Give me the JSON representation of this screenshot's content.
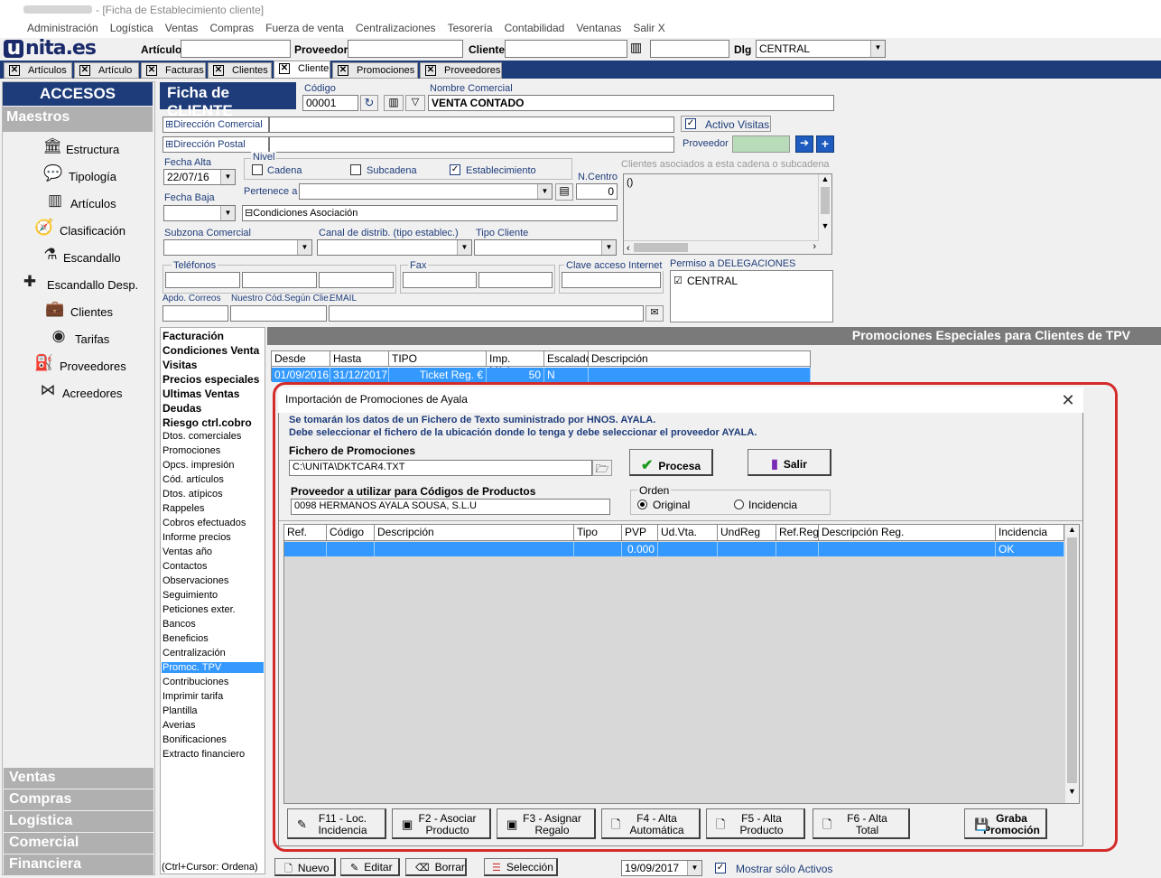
{
  "window": {
    "title": "- [Ficha de Establecimiento cliente]"
  },
  "menu": [
    "Administración",
    "Logística",
    "Ventas",
    "Compras",
    "Fuerza de venta",
    "Centralizaciones",
    "Tesorería",
    "Contabilidad",
    "Ventanas",
    "Salir X"
  ],
  "toolbar": {
    "logo": "unita.es",
    "articulo_label": "Artículo",
    "proveedor_label": "Proveedor",
    "cliente_label": "Cliente",
    "dlg_label": "Dlg",
    "dlg_value": "CENTRAL"
  },
  "tabs": [
    "Artículos",
    "Artículo",
    "Facturas",
    "Clientes",
    "Cliente",
    "Promociones",
    "Proveedores"
  ],
  "active_tab": "Cliente",
  "left": {
    "accesos": "ACCESOS RAPIDOS",
    "maestros": "Maestros",
    "items": [
      {
        "label": "Estructura",
        "icon": "building-icon"
      },
      {
        "label": "Tipología",
        "icon": "chat-icon"
      },
      {
        "label": "Artículos",
        "icon": "barcode-icon"
      },
      {
        "label": "Clasificación",
        "icon": "compass-icon"
      },
      {
        "label": "Escandallo",
        "icon": "flask-icon"
      },
      {
        "label": "Escandallo Desp.",
        "icon": "puzzle-icon"
      },
      {
        "label": "Clientes",
        "icon": "briefcase-icon"
      },
      {
        "label": "Tarifas",
        "icon": "coin-icon"
      },
      {
        "label": "Proveedores",
        "icon": "fuel-icon"
      },
      {
        "label": "Acreedores",
        "icon": "bowtie-icon"
      }
    ],
    "sections": [
      "Ventas",
      "Compras",
      "Logística",
      "Comercial",
      "Financiera"
    ]
  },
  "ficha": {
    "header": "Ficha de CLIENTE",
    "codigo_label": "Código",
    "codigo": "00001",
    "nombre_label": "Nombre Comercial",
    "nombre": "VENTA CONTADO",
    "dir_comercial": "Dirección Comercial",
    "dir_postal": "Dirección Postal",
    "activo_visitas": "Activo Visitas",
    "proveedor_label": "Proveedor",
    "fecha_alta_label": "Fecha Alta",
    "fecha_alta": "22/07/16",
    "nivel_label": "Nivel",
    "cadena": "Cadena",
    "subcadena": "Subcadena",
    "establecimiento": "Establecimiento",
    "ncentro_label": "N.Centro",
    "ncentro": "0",
    "clientes_asociados": "Clientes asociados a esta cadena o subcadena",
    "clientes_asociados_value": "()",
    "fecha_baja_label": "Fecha Baja",
    "pertenece_label": "Pertenece a",
    "condiciones": "Condiciones Asociación",
    "subzona_label": "Subzona Comercial",
    "canal_label": "Canal de distrib. (tipo establec.)",
    "tipo_cliente_label": "Tipo Cliente",
    "telefonos_label": "Teléfonos",
    "fax_label": "Fax",
    "clave_label": "Clave acceso Internet",
    "permiso_label": "Permiso a DELEGACIONES",
    "permiso_value": "CENTRAL",
    "apdo_label": "Apdo. Correos",
    "nuestro_label": "Nuestro Cód.Según Clie.",
    "email_label": "EMAIL"
  },
  "sidelinks": [
    {
      "label": "Facturación",
      "bold": true
    },
    {
      "label": "Condiciones Venta",
      "bold": true
    },
    {
      "label": "Visitas",
      "bold": true
    },
    {
      "label": "Precios especiales",
      "bold": true
    },
    {
      "label": "Ultimas Ventas",
      "bold": true
    },
    {
      "label": "Deudas",
      "bold": true
    },
    {
      "label": "Riesgo ctrl.cobro",
      "bold": true
    },
    {
      "label": "Dtos. comerciales"
    },
    {
      "label": "Promociones"
    },
    {
      "label": "Opcs. impresión"
    },
    {
      "label": "Cód. artículos"
    },
    {
      "label": "Dtos. atípicos"
    },
    {
      "label": "Rappeles"
    },
    {
      "label": "Cobros efectuados"
    },
    {
      "label": "Informe precios"
    },
    {
      "label": "Ventas año"
    },
    {
      "label": "Contactos"
    },
    {
      "label": "Observaciones"
    },
    {
      "label": "Seguimiento"
    },
    {
      "label": "Peticiones exter."
    },
    {
      "label": "Bancos"
    },
    {
      "label": "Beneficios"
    },
    {
      "label": "Centralización"
    },
    {
      "label": "Promoc. TPV",
      "selected": true
    },
    {
      "label": "Contribuciones"
    },
    {
      "label": "Imprimir tarifa"
    },
    {
      "label": "Plantilla"
    },
    {
      "label": "Averias"
    },
    {
      "label": "Bonificaciones"
    },
    {
      "label": "Extracto financiero"
    }
  ],
  "sidelinks_footer": "(Ctrl+Cursor: Ordena)",
  "promos": {
    "header": "Promociones Especiales para Clientes de TPV",
    "columns": [
      "Desde",
      "Hasta",
      "TIPO",
      "Imp. Mínimo",
      "Escalado",
      "Descripción"
    ],
    "row": [
      "01/09/2016",
      "31/12/2017",
      "Ticket Reg. €",
      "50",
      "N",
      ""
    ]
  },
  "dialog": {
    "title": "Importación de Promociones de Ayala",
    "info1": "Se tomarán los datos de un Fichero de Texto suministrado por HNOS. AYALA.",
    "info2": "Debe seleccionar el fichero de la ubicación donde lo tenga y debe seleccionar el proveedor AYALA.",
    "fichero_label": "Fichero de Promociones",
    "fichero": "C:\\UNITA\\DKTCAR4.TXT",
    "proveedor_label": "Proveedor a utilizar para Códigos de Productos",
    "proveedor": "0098 HERMANOS AYALA SOUSA, S.L.U",
    "procesa": "Procesa",
    "salir": "Salir",
    "orden_label": "Orden",
    "original": "Original",
    "incidencia": "Incidencia",
    "columns": [
      "Ref.",
      "Código",
      "Descripción",
      "Tipo",
      "PVP",
      "Ud.Vta.",
      "UndReg",
      "Ref.Reg.",
      "Descripción Reg.",
      "Incidencia"
    ],
    "row": [
      "",
      "",
      "",
      "",
      "0.000",
      "",
      "",
      "",
      "",
      "OK"
    ],
    "buttons": [
      {
        "l1": "F11 - Loc.",
        "l2": "Incidencia"
      },
      {
        "l1": "F2 - Asociar",
        "l2": "Producto"
      },
      {
        "l1": "F3 - Asignar",
        "l2": "Regalo"
      },
      {
        "l1": "F4 - Alta",
        "l2": "Automática"
      },
      {
        "l1": "F5 - Alta",
        "l2": "Producto"
      },
      {
        "l1": "F6 - Alta",
        "l2": "Total"
      },
      {
        "l1": "Graba",
        "l2": "Promoción"
      }
    ]
  },
  "bottom": {
    "nuevo": "Nuevo",
    "editar": "Editar",
    "borrar": "Borrar",
    "seleccion": "Selección",
    "fecha": "19/09/2017",
    "mostrar": "Mostrar sólo Activos"
  }
}
